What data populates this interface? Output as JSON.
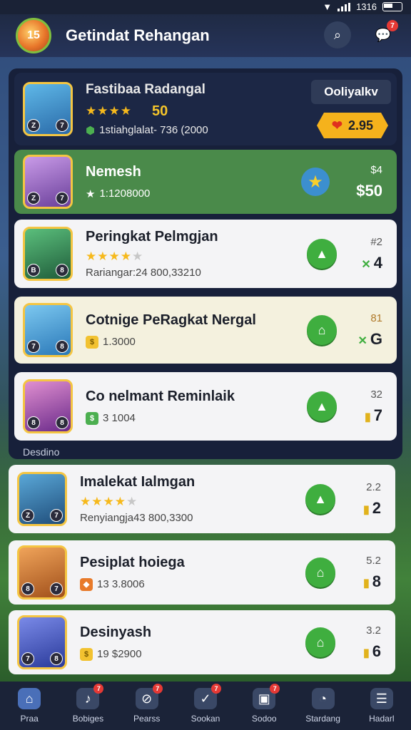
{
  "status_bar": {
    "time": "1316"
  },
  "header": {
    "title": "Getindat Rehangan",
    "logo_text": "15",
    "chat_badge": "7"
  },
  "top_card": {
    "name": "Fastibaa Radangal",
    "score": "50",
    "subtitle": "1stiahglalat- 736 (2000",
    "follow_label": "Ooliyalkv",
    "price": "2.95",
    "avatar_levels": [
      "Z",
      "7"
    ]
  },
  "players": [
    {
      "name": "Nemesh",
      "sub": "1:1208000",
      "score": "$4",
      "pos": "$50",
      "levels": [
        "Z",
        "7"
      ],
      "style": "green",
      "avatar": "#a07cc8"
    },
    {
      "name": "Peringkat Pelmgjan",
      "sub": "Rariangar:24 800,33210",
      "score": "#2",
      "pos": "4",
      "levels": [
        "B",
        "8"
      ],
      "style": "white",
      "avatar": "#2e7d4f"
    },
    {
      "name": "Cotnige PeRagkat Nergal",
      "sub": "1.3000",
      "score": "81",
      "pos": "G",
      "levels": [
        "7",
        "8"
      ],
      "style": "cream",
      "avatar": "#3a9ad9"
    },
    {
      "name": "Co nelmant Reminlaik",
      "sub": "3 1004",
      "score": "32",
      "pos": "7",
      "levels": [
        "8",
        "8"
      ],
      "style": "white",
      "avatar": "#8b3fa0"
    }
  ],
  "section_label": "Desdino",
  "players2": [
    {
      "name": "Imalekat Ialmgan",
      "sub": "Renyiangja43 800,3300",
      "score": "2.2",
      "pos": "2",
      "levels": [
        "Z",
        "7"
      ],
      "avatar": "#1f5d8a"
    },
    {
      "name": "Pesiplat hoiega",
      "sub": "13  3.8006",
      "score": "5.2",
      "pos": "8",
      "levels": [
        "8",
        "7"
      ],
      "avatar": "#d97a2a"
    },
    {
      "name": "Desinyash",
      "sub": "19  $2900",
      "score": "3.2",
      "pos": "6",
      "levels": [
        "7",
        "8"
      ],
      "avatar": "#3b4fb0"
    }
  ],
  "nav": [
    {
      "label": "Praa",
      "icon": "home-icon",
      "badge": ""
    },
    {
      "label": "Bobiges",
      "icon": "music-icon",
      "badge": "7"
    },
    {
      "label": "Pearss",
      "icon": "slash-icon",
      "badge": "7"
    },
    {
      "label": "Sookan",
      "icon": "check-icon",
      "badge": "7"
    },
    {
      "label": "Sodoo",
      "icon": "box-icon",
      "badge": "7"
    },
    {
      "label": "Stardang",
      "icon": "gauge-icon",
      "badge": ""
    },
    {
      "label": "Hadarl",
      "icon": "menu-icon",
      "badge": ""
    }
  ],
  "colors": {
    "accent": "#3fae3f",
    "gold": "#f5b21c",
    "header": "#1f2a44"
  }
}
